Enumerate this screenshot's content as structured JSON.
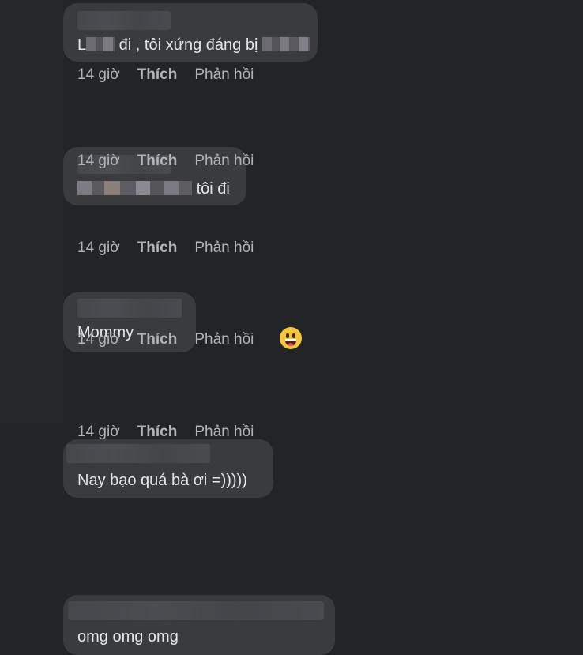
{
  "comments": [
    {
      "text_before": "L",
      "text_mid": " đi , tôi xứng đáng bị",
      "text_after": ""
    },
    {
      "text": "tôi đi"
    },
    {
      "text": "Mommy"
    },
    {
      "text": "Nay bạo quá bà ơi =)))))"
    },
    {
      "text": "omg omg omg"
    }
  ],
  "actions": {
    "time": "14 giờ",
    "like": "Thích",
    "reply": "Phản hồi"
  },
  "reaction_icon": "grinning-face-emoji"
}
